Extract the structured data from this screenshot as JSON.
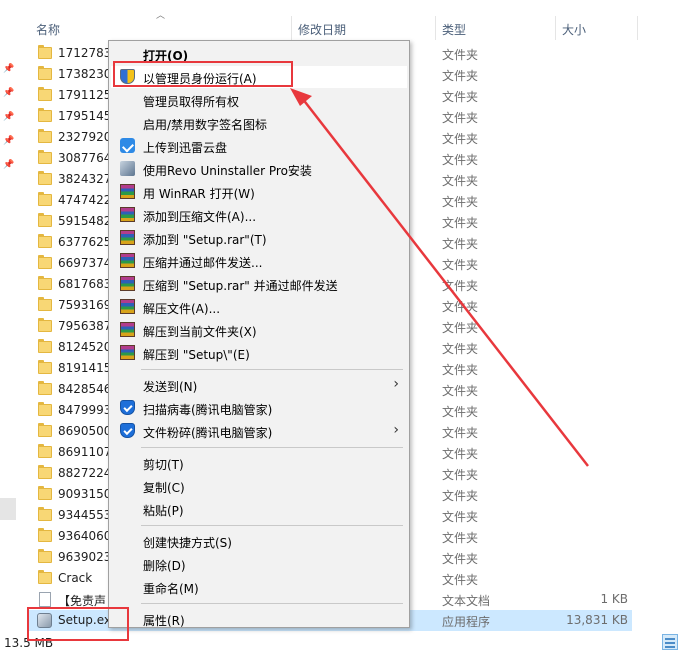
{
  "columns": {
    "name": "名称",
    "date": "修改日期",
    "type": "类型",
    "size": "大小"
  },
  "files": [
    {
      "name": "1712783",
      "type": "文件夹",
      "size": "",
      "kind": "folder"
    },
    {
      "name": "1738230",
      "type": "文件夹",
      "size": "",
      "kind": "folder"
    },
    {
      "name": "1791125",
      "type": "文件夹",
      "size": "",
      "kind": "folder"
    },
    {
      "name": "1795145",
      "type": "文件夹",
      "size": "",
      "kind": "folder"
    },
    {
      "name": "2327920",
      "type": "文件夹",
      "size": "",
      "kind": "folder"
    },
    {
      "name": "3087764",
      "type": "文件夹",
      "size": "",
      "kind": "folder"
    },
    {
      "name": "3824327",
      "type": "文件夹",
      "size": "",
      "kind": "folder"
    },
    {
      "name": "4747422",
      "type": "文件夹",
      "size": "",
      "kind": "folder"
    },
    {
      "name": "5915482",
      "type": "文件夹",
      "size": "",
      "kind": "folder"
    },
    {
      "name": "6377625",
      "type": "文件夹",
      "size": "",
      "kind": "folder"
    },
    {
      "name": "6697374",
      "type": "文件夹",
      "size": "",
      "kind": "folder"
    },
    {
      "name": "6817683",
      "type": "文件夹",
      "size": "",
      "kind": "folder"
    },
    {
      "name": "7593169",
      "type": "文件夹",
      "size": "",
      "kind": "folder"
    },
    {
      "name": "7956387",
      "type": "文件夹",
      "size": "",
      "kind": "folder"
    },
    {
      "name": "8124520",
      "type": "文件夹",
      "size": "",
      "kind": "folder"
    },
    {
      "name": "8191415",
      "type": "文件夹",
      "size": "",
      "kind": "folder"
    },
    {
      "name": "8428546",
      "type": "文件夹",
      "size": "",
      "kind": "folder"
    },
    {
      "name": "8479993",
      "type": "文件夹",
      "size": "",
      "kind": "folder"
    },
    {
      "name": "8690500",
      "type": "文件夹",
      "size": "",
      "kind": "folder"
    },
    {
      "name": "8691107",
      "type": "文件夹",
      "size": "",
      "kind": "folder"
    },
    {
      "name": "8827224",
      "type": "文件夹",
      "size": "",
      "kind": "folder"
    },
    {
      "name": "9093150",
      "type": "文件夹",
      "size": "",
      "kind": "folder"
    },
    {
      "name": "9344553",
      "type": "文件夹",
      "size": "",
      "kind": "folder"
    },
    {
      "name": "9364060",
      "type": "文件夹",
      "size": "",
      "kind": "folder"
    },
    {
      "name": "9639023",
      "type": "文件夹",
      "size": "",
      "kind": "folder"
    },
    {
      "name": "Crack",
      "type": "文件夹",
      "size": "",
      "kind": "folder"
    },
    {
      "name": "【免责声",
      "type": "文本文档",
      "size": "1 KB",
      "kind": "doc"
    },
    {
      "name": "Setup.ex",
      "type": "应用程序",
      "size": "13,831 KB",
      "kind": "exe",
      "selected": true
    }
  ],
  "status": {
    "size": "13.5 MB"
  },
  "context_menu": [
    {
      "label": "打开(O)",
      "icon": "none",
      "bold": true
    },
    {
      "label": "以管理员身份运行(A)",
      "icon": "uac-shield-icon",
      "highlighted": true
    },
    {
      "label": "管理员取得所有权",
      "icon": "none"
    },
    {
      "label": "启用/禁用数字签名图标",
      "icon": "none"
    },
    {
      "label": "上传到迅雷云盘",
      "icon": "xunlei-icon"
    },
    {
      "label": "使用Revo Uninstaller Pro安装",
      "icon": "revo-icon"
    },
    {
      "label": "用 WinRAR 打开(W)",
      "icon": "winrar-icon"
    },
    {
      "label": "添加到压缩文件(A)...",
      "icon": "winrar-icon"
    },
    {
      "label": "添加到 \"Setup.rar\"(T)",
      "icon": "winrar-icon"
    },
    {
      "label": "压缩并通过邮件发送...",
      "icon": "winrar-icon"
    },
    {
      "label": "压缩到 \"Setup.rar\" 并通过邮件发送",
      "icon": "winrar-icon"
    },
    {
      "label": "解压文件(A)...",
      "icon": "winrar-icon"
    },
    {
      "label": "解压到当前文件夹(X)",
      "icon": "winrar-icon"
    },
    {
      "label": "解压到 \"Setup\\\"(E)",
      "icon": "winrar-icon"
    },
    {
      "sep": true
    },
    {
      "label": "发送到(N)",
      "icon": "none",
      "submenu": true
    },
    {
      "label": "扫描病毒(腾讯电脑管家)",
      "icon": "tencent-guard-icon"
    },
    {
      "label": "文件粉碎(腾讯电脑管家)",
      "icon": "tencent-guard-icon",
      "submenu": true
    },
    {
      "sep": true
    },
    {
      "label": "剪切(T)",
      "icon": "none"
    },
    {
      "label": "复制(C)",
      "icon": "none"
    },
    {
      "label": "粘贴(P)",
      "icon": "none"
    },
    {
      "sep": true
    },
    {
      "label": "创建快捷方式(S)",
      "icon": "none"
    },
    {
      "label": "删除(D)",
      "icon": "none"
    },
    {
      "label": "重命名(M)",
      "icon": "none"
    },
    {
      "sep": true
    },
    {
      "label": "属性(R)",
      "icon": "none"
    }
  ],
  "annotation_color": "#e8383d"
}
